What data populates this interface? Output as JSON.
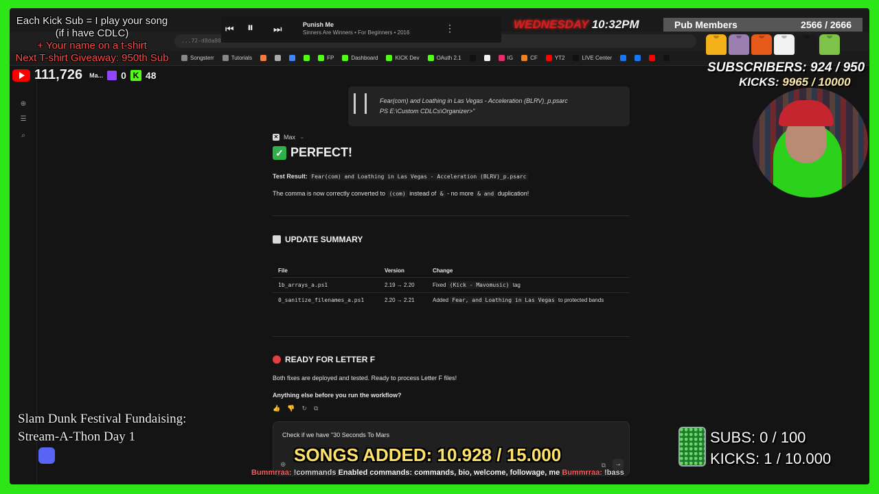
{
  "overlay": {
    "kick_sub_promo": [
      "Each Kick Sub = I play your song",
      "(if i have CDLC)",
      "+ Your name on a t-shirt"
    ],
    "giveaway": "Next T-shirt Giveaway: 950th Sub",
    "youtube_count": "111,726",
    "twitch_label": "Ma...",
    "twitch_count": "0",
    "kick_count": "48",
    "clock_day": "WEDNESDAY",
    "clock_time": "10:32PM",
    "pub_members_label": "Pub Members",
    "pub_members_value": "2566 / 2666",
    "subscribers_goal": "SUBSCRIBERS: 924 / 950",
    "kicks_goal_label": "KICKS:",
    "kicks_goal_value": "9965 / 10000",
    "fundraising_title": "Slam Dunk Festival Fundaising:",
    "fundraising_sub": "Stream-A-Thon Day 1",
    "songs_added": "SONGS ADDED: 10.928 / 15.000",
    "subs_goal": "SUBS:  0 / 100",
    "kicks_goal": "KICKS: 1 / 10.000",
    "ticker_text": "Enabled commands: commands, bio, welcome, followage, me",
    "ticker_user": "Bummrraa:",
    "ticker_cmd": "!commands",
    "ticker_user2": "Bummrraa:",
    "ticker_cmd2": "!bass",
    "shirt_colors": [
      "#f4b21a",
      "#9a7fb0",
      "#e85a1a",
      "#f2f2f2",
      "#1b1b1b",
      "#7ec24a"
    ]
  },
  "player": {
    "song_title": "Punish Me",
    "song_sub": "Sinners Are Winners • For Beginners • 2016"
  },
  "browser": {
    "address": "...72-d8da801164...",
    "bookmarks": [
      {
        "label": "Songsterr",
        "color": "#888"
      },
      {
        "label": "Tutorials",
        "color": "#888"
      },
      {
        "label": "",
        "color": "#ff7a3a"
      },
      {
        "label": "",
        "color": "#aaa"
      },
      {
        "label": "",
        "color": "#4285f4"
      },
      {
        "label": "",
        "color": "#53fc18"
      },
      {
        "label": "FP",
        "color": "#53fc18"
      },
      {
        "label": "Dashboard",
        "color": "#53fc18"
      },
      {
        "label": "KICK Dev",
        "color": "#53fc18"
      },
      {
        "label": "OAuth 2.1",
        "color": "#53fc18"
      },
      {
        "label": "",
        "color": "#111"
      },
      {
        "label": "",
        "color": "#f2f2f2"
      },
      {
        "label": "IG",
        "color": "#e1306c"
      },
      {
        "label": "CF",
        "color": "#f38020"
      },
      {
        "label": "YT2",
        "color": "#ff0000"
      },
      {
        "label": "LIVE Center",
        "color": "#111"
      },
      {
        "label": "",
        "color": "#1877f2"
      },
      {
        "label": "",
        "color": "#1877f2"
      },
      {
        "label": "",
        "color": "#ff0000"
      },
      {
        "label": "",
        "color": "#111"
      }
    ]
  },
  "chat": {
    "code_line1": "Fear(com) and Loathing in Las Vegas - Acceleration (BLRV)_p.psarc",
    "code_line2": "PS E:\\Custom CDLCs\\Organizer>\"",
    "author": "Max",
    "perfect_heading": "PERFECT!",
    "test_result_label": "Test Result:",
    "test_result_value": "Fear(com) and Loathing in Las Vegas - Acceleration (BLRV)_p.psarc",
    "comma_text_1": "The comma is now correctly converted to",
    "comma_code_1": "(com)",
    "comma_text_2": "instead of",
    "comma_code_2": "&",
    "comma_text_3": "- no more",
    "comma_code_3": "& and",
    "comma_text_4": "duplication!",
    "update_heading": "UPDATE SUMMARY",
    "table_headers": [
      "File",
      "Version",
      "Change"
    ],
    "table_rows": [
      {
        "file": "1b_arrays_a.ps1",
        "version": "2.19 → 2.20",
        "change_a": "Fixed",
        "change_code": "(Kick - Mavomusic)",
        "change_b": "tag"
      },
      {
        "file": "0_sanitize_filenames_a.ps1",
        "version": "2.20 → 2.21",
        "change_a": "Added",
        "change_code": "Fear, and Loathing in Las Vegas",
        "change_b": "to protected bands"
      }
    ],
    "ready_heading": "READY FOR LETTER F",
    "ready_text": "Both fixes are deployed and tested. Ready to process Letter F files!",
    "question_text": "Anything else before you run the workflow?",
    "input_value": "Check if we have \"30 Seconds To Mars"
  }
}
